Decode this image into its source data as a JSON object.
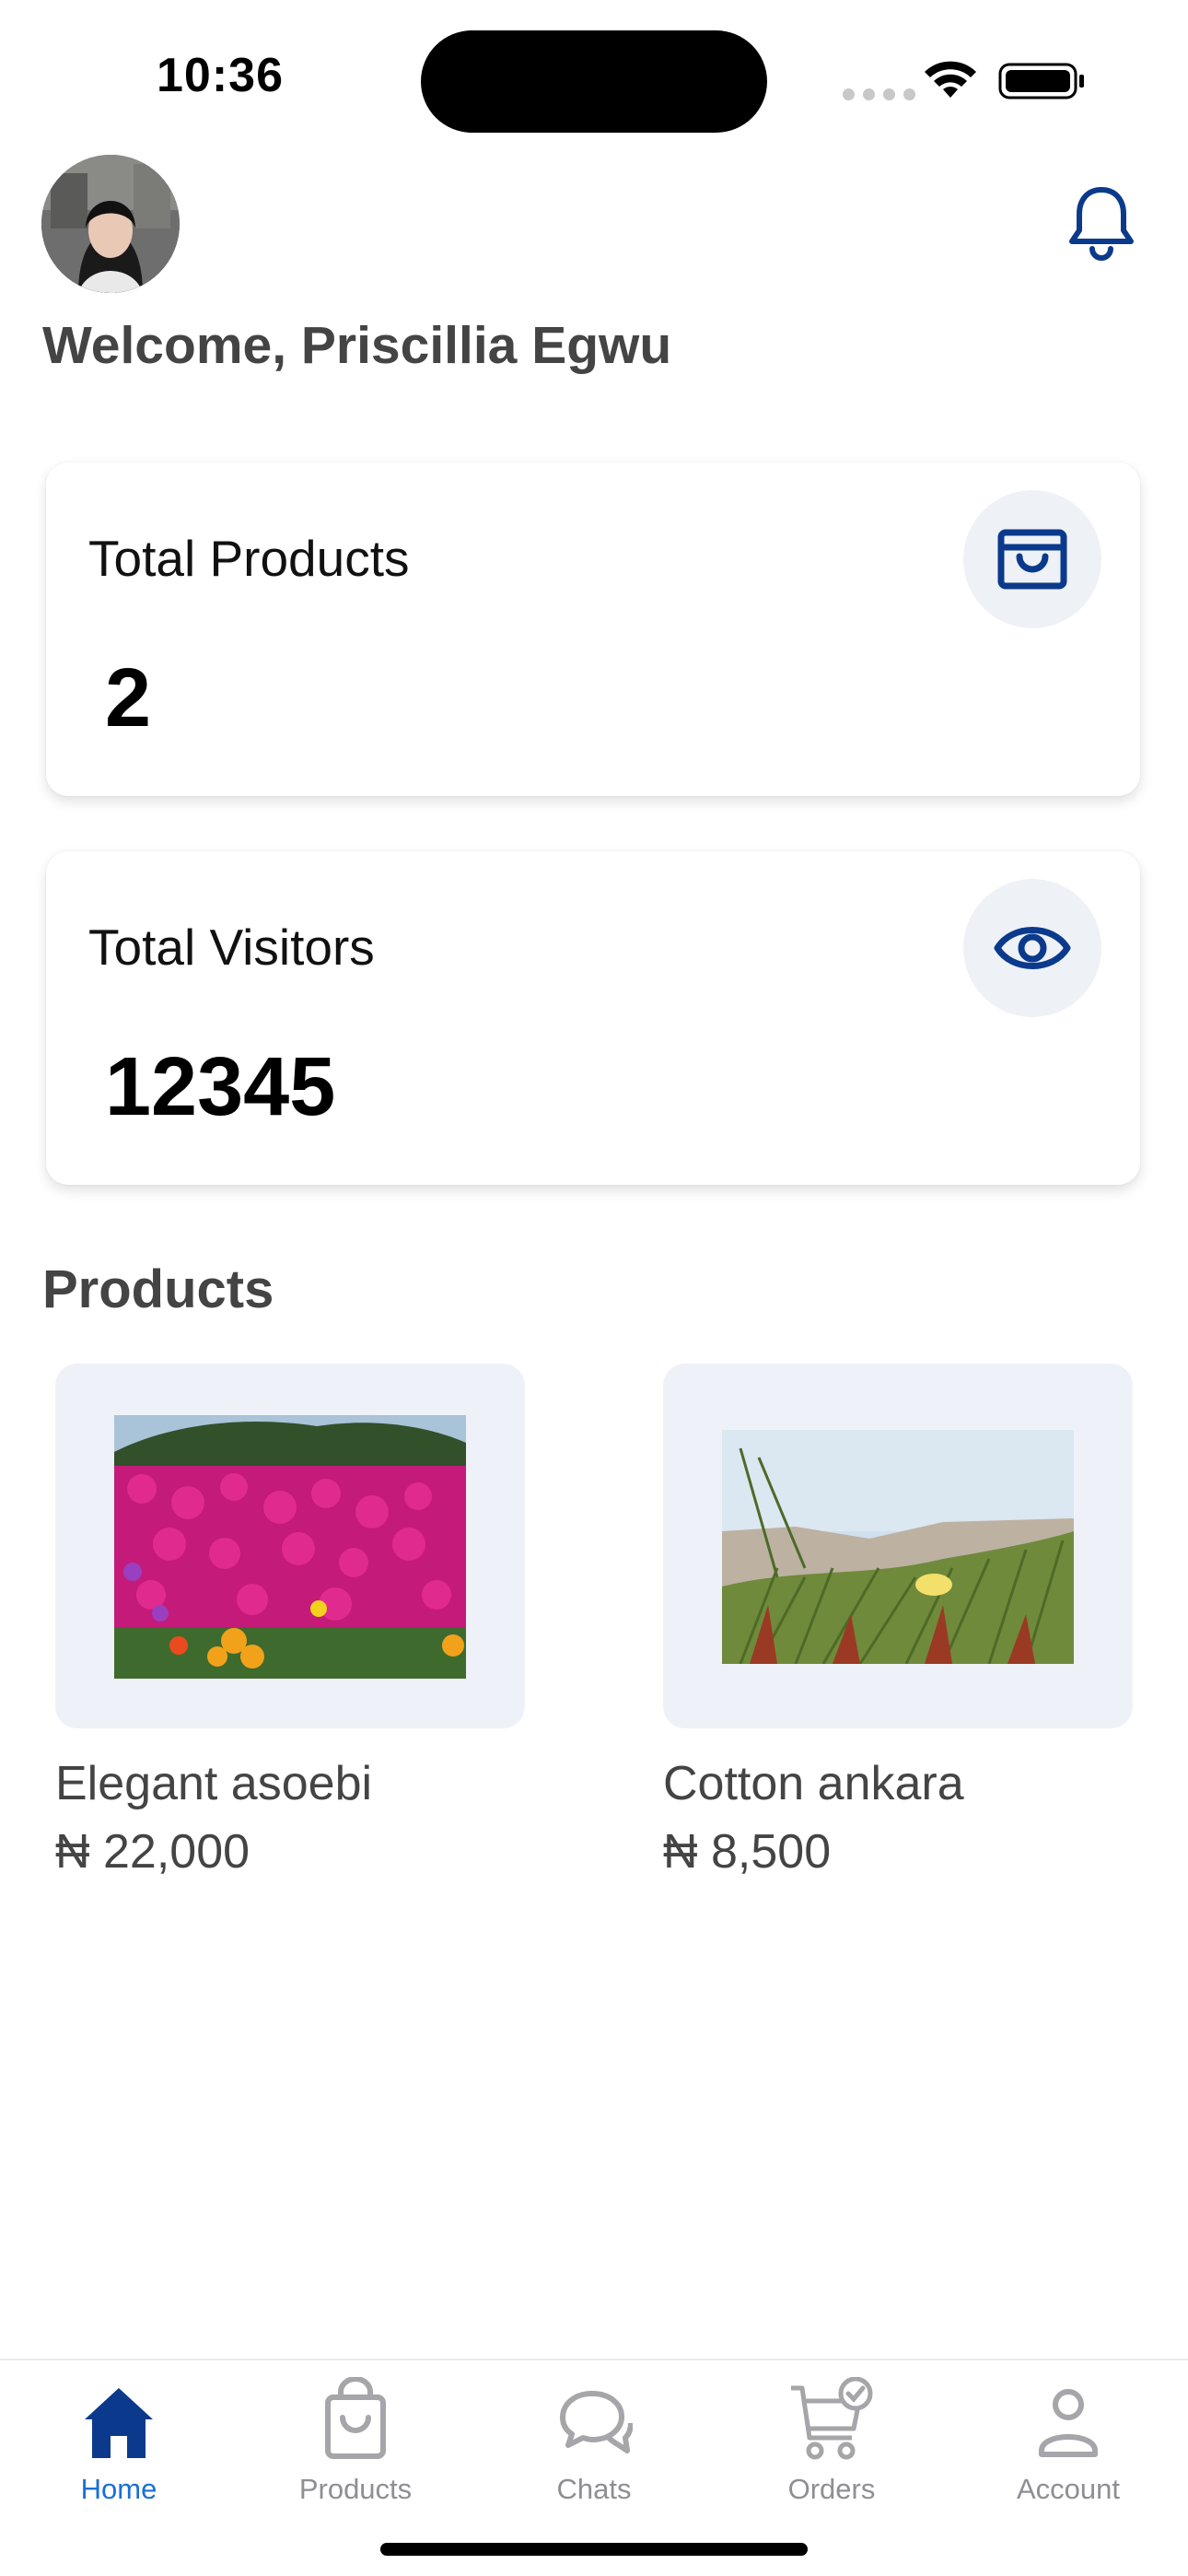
{
  "status_bar": {
    "time": "10:36"
  },
  "header": {
    "welcome_text": "Welcome, Priscillia Egwu",
    "avatar_icon": "user-avatar",
    "notification_icon": "bell-icon"
  },
  "stats": [
    {
      "label": "Total Products",
      "value": "2",
      "icon": "shopping-bag-icon"
    },
    {
      "label": "Total Visitors",
      "value": "12345",
      "icon": "eye-icon"
    }
  ],
  "products_section": {
    "title": "Products",
    "items": [
      {
        "name": "Elegant asoebi",
        "price": "₦ 22,000",
        "image": "pink-flowers-photo"
      },
      {
        "name": "Cotton ankara",
        "price": "₦ 8,500",
        "image": "beach-grass-photo"
      }
    ]
  },
  "tab_bar": {
    "tabs": [
      {
        "label": "Home",
        "icon": "home-icon",
        "active": true
      },
      {
        "label": "Products",
        "icon": "bag-icon",
        "active": false
      },
      {
        "label": "Chats",
        "icon": "chat-bubbles-icon",
        "active": false
      },
      {
        "label": "Orders",
        "icon": "cart-check-icon",
        "active": false
      },
      {
        "label": "Account",
        "icon": "person-icon",
        "active": false
      }
    ]
  },
  "colors": {
    "accent": "#0b3a8c",
    "active_tab": "#1a6fd6",
    "inactive_tab": "#8e8e93",
    "icon_circle_bg": "#eef1f6",
    "product_frame_bg": "#eef2f8"
  }
}
